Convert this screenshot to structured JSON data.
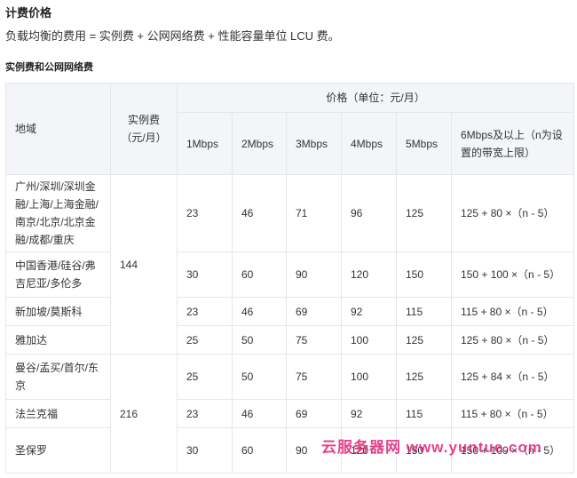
{
  "heading": "计费价格",
  "description": "负载均衡的费用 = 实例费 + 公网网络费 + 性能容量单位 LCU 费。",
  "subheading": "实例费和公网网络费",
  "table": {
    "header": {
      "region": "地域",
      "instance_fee": "实例费（元/月）",
      "price_group": "价格（单位：元/月）",
      "bandwidths": [
        "1Mbps",
        "2Mbps",
        "3Mbps",
        "4Mbps",
        "5Mbps",
        "6Mbps及以上（n为设置的带宽上限）"
      ]
    },
    "groups": [
      {
        "instance_fee": "144",
        "rows": [
          {
            "region": "广州/深圳/深圳金融/上海/上海金融/南京/北京/北京金融/成都/重庆",
            "prices": [
              "23",
              "46",
              "71",
              "96",
              "125",
              "125 + 80 ×（n - 5）"
            ]
          },
          {
            "region": "中国香港/硅谷/弗吉尼亚/多伦多",
            "prices": [
              "30",
              "60",
              "90",
              "120",
              "150",
              "150 + 100 ×（n - 5）"
            ]
          },
          {
            "region": "新加坡/莫斯科",
            "prices": [
              "23",
              "46",
              "69",
              "92",
              "115",
              "115 + 80 ×（n - 5）"
            ]
          },
          {
            "region": "雅加达",
            "prices": [
              "25",
              "50",
              "75",
              "100",
              "125",
              "125 + 80 ×（n - 5）"
            ]
          }
        ]
      },
      {
        "instance_fee": "216",
        "rows": [
          {
            "region": "曼谷/孟买/首尔/东京",
            "prices": [
              "25",
              "50",
              "75",
              "100",
              "125",
              "125 + 84 ×（n - 5）"
            ]
          },
          {
            "region": "法兰克福",
            "prices": [
              "23",
              "46",
              "69",
              "92",
              "115",
              "115 + 80 ×（n - 5）"
            ]
          },
          {
            "region": "圣保罗",
            "prices": [
              "30",
              "60",
              "90",
              "120",
              "150",
              "150 + 100 ×（n - 5）"
            ]
          }
        ]
      }
    ]
  },
  "watermark": "云服务器网 www.yuntue.com",
  "colors": {
    "header_bg": "#f3f5f8",
    "border": "#e3e6eb",
    "watermark": "#e0207a"
  }
}
